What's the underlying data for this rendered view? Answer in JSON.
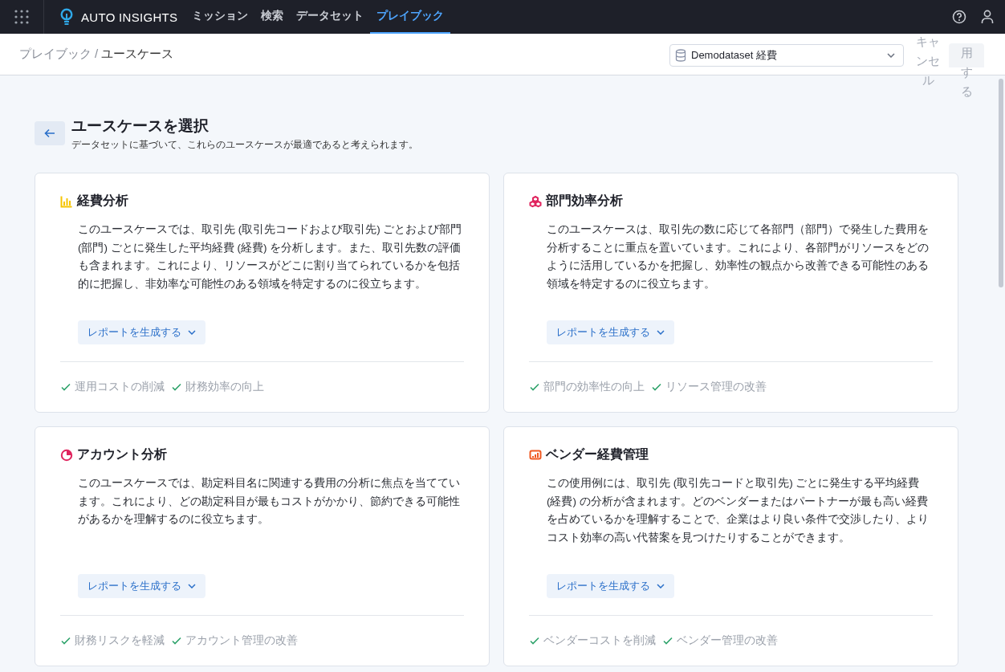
{
  "navbar": {
    "brand": "AUTO INSIGHTS",
    "tabs": [
      {
        "label": "ミッション",
        "selected": false
      },
      {
        "label": "検索",
        "selected": false
      },
      {
        "label": "データセット",
        "selected": false
      },
      {
        "label": "プレイブック",
        "selected": true
      }
    ]
  },
  "breadcrumb": {
    "parent": "プレイブック",
    "separator": "/",
    "current": "ユースケース"
  },
  "dataset_select": {
    "value": "Demodataset 経費"
  },
  "actions": {
    "cancel": "キャンセル",
    "apply": "用する"
  },
  "heading": {
    "title": "ユースケースを選択",
    "subtitle": "データセットに基づいて、これらのユースケースが最適であると考えられます。"
  },
  "cards": [
    {
      "kind": "bar-chart",
      "color": "#f5c400",
      "title": "経費分析",
      "description": "このユースケースでは、取引先 (取引先コードおよび取引先) ごとおよび部門 (部門) ごとに発生した平均経費 (経費) を分析します。また、取引先数の評価も含まれます。これにより、リソースがどこに割り当てられているかを包括的に把握し、非効率な可能性のある領域を特定するのに役立ちます。",
      "button": "レポートを生成する",
      "benefits": [
        "運用コストの削減",
        "財務効率の向上"
      ]
    },
    {
      "kind": "cubes",
      "color": "#e0245e",
      "title": "部門効率分析",
      "description": "このユースケースは、取引先の数に応じて各部門（部門）で発生した費用を分析することに重点を置いています。これにより、各部門がリソースをどのように活用しているかを把握し、効率性の観点から改善できる可能性のある領域を特定するのに役立ちます。",
      "button": "レポートを生成する",
      "benefits": [
        "部門の効率性の向上",
        "リソース管理の改善"
      ]
    },
    {
      "kind": "pie-chart",
      "color": "#e0245e",
      "title": "アカウント分析",
      "description": "このユースケースでは、勘定科目名に関連する費用の分析に焦点を当てています。これにより、どの勘定科目が最もコストがかかり、節約できる可能性があるかを理解するのに役立ちます。",
      "button": "レポートを生成する",
      "benefits": [
        "財務リスクを軽減",
        "アカウント管理の改善"
      ]
    },
    {
      "kind": "presentation-chart",
      "color": "#f05a22",
      "title": "ベンダー経費管理",
      "description": "この使用例には、取引先 (取引先コードと取引先) ごとに発生する平均経費 (経費) の分析が含まれます。どのベンダーまたはパートナーが最も高い経費を占めているかを理解することで、企業はより良い条件で交渉したり、よりコスト効率の高い代替案を見つけたりすることができます。",
      "button": "レポートを生成する",
      "benefits": [
        "ベンダーコストを削減",
        "ベンダー管理の改善"
      ]
    }
  ]
}
